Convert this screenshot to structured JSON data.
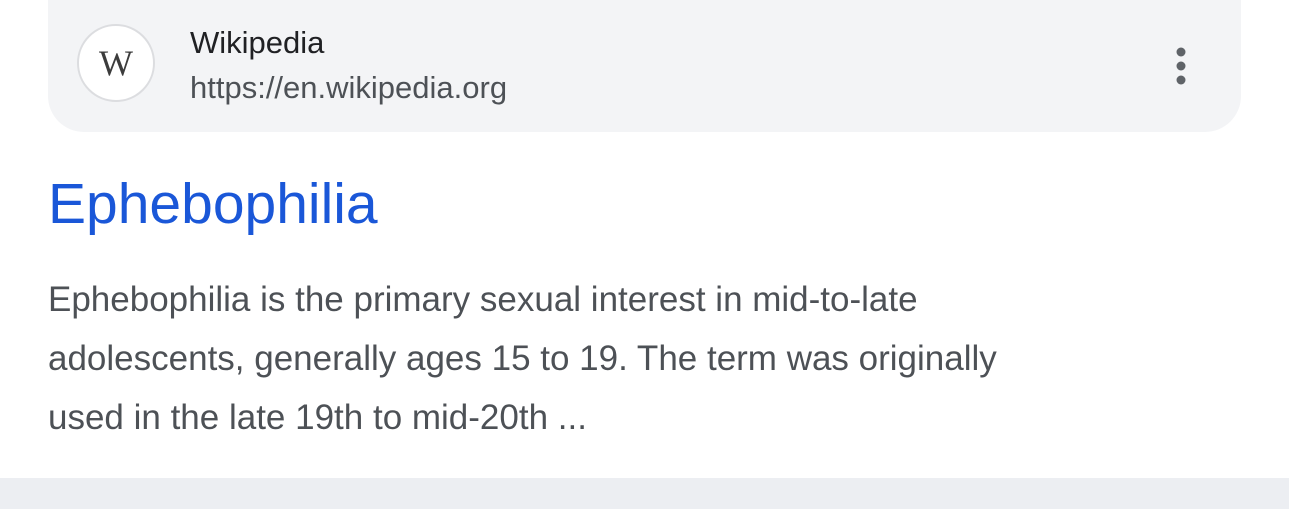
{
  "result": {
    "source": {
      "favicon_letter": "W",
      "favicon_icon": "wikipedia-w-icon",
      "site_name": "Wikipedia",
      "url": "https://en.wikipedia.org",
      "more_icon": "more-vertical-icon"
    },
    "title": "Ephebophilia",
    "snippet_lines": [
      "Ephebophilia is the primary sexual interest in mid-to-late",
      "adolescents, generally ages 15 to 19. The term was originally",
      "used in the late 19th to mid-20th ..."
    ]
  },
  "colors": {
    "title_link": "#1a57d8",
    "source_bar_bg": "#f3f4f6",
    "body_text": "#4d5156",
    "site_name_text": "#202124"
  }
}
